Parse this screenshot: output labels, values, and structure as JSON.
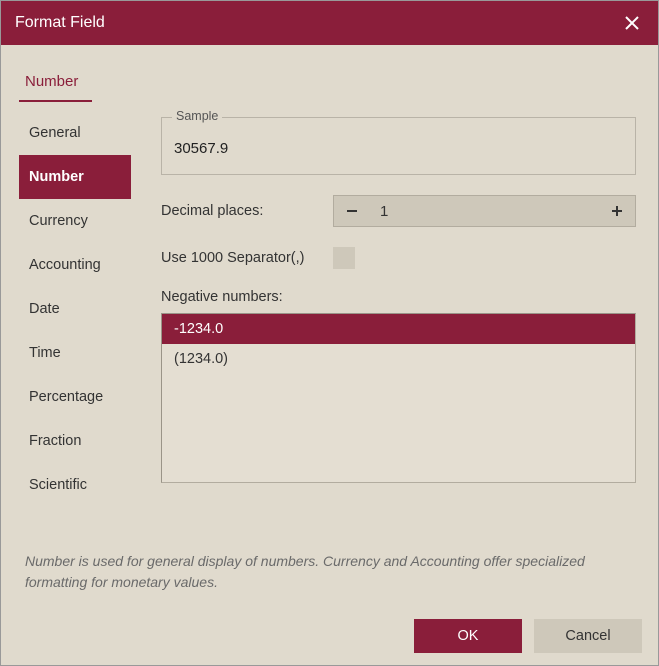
{
  "title": "Format Field",
  "tabstrip": {
    "active": "Number"
  },
  "sidebar": {
    "items": [
      {
        "label": "General"
      },
      {
        "label": "Number",
        "selected": true
      },
      {
        "label": "Currency"
      },
      {
        "label": "Accounting"
      },
      {
        "label": "Date"
      },
      {
        "label": "Time"
      },
      {
        "label": "Percentage"
      },
      {
        "label": "Fraction"
      },
      {
        "label": "Scientific"
      }
    ]
  },
  "sample": {
    "label": "Sample",
    "value": "30567.9"
  },
  "decimal": {
    "label": "Decimal places:",
    "value": "1"
  },
  "separator": {
    "label": "Use 1000 Separator(,)",
    "checked": false
  },
  "negative": {
    "label": "Negative numbers:",
    "options": [
      {
        "text": "-1234.0",
        "selected": true
      },
      {
        "text": "(1234.0)"
      }
    ]
  },
  "description": "Number is used for general display of numbers. Currency and Accounting offer specialized formatting for monetary values.",
  "buttons": {
    "ok": "OK",
    "cancel": "Cancel"
  }
}
